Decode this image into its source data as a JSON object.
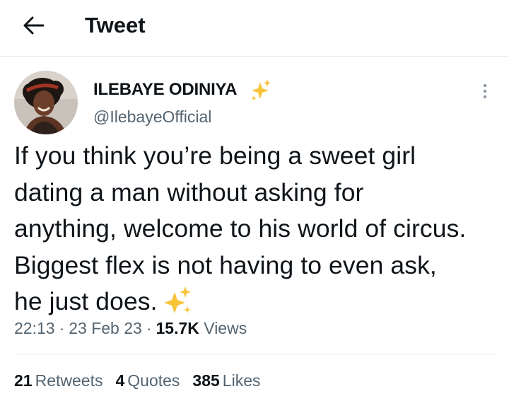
{
  "header": {
    "title": "Tweet",
    "back_icon": "arrow-left-icon"
  },
  "author": {
    "display_name": "ILEBAYE ODINIYA",
    "handle": "@IlebayeOfficial",
    "badge_icon": "sparkles-icon",
    "badge_color": "#f5b800"
  },
  "tweet": {
    "text": "If you think you’re being a sweet girl dating a man without asking for anything, welcome to his world of circus. Biggest flex is not having to even ask, he just does.",
    "trailing_icon": "sparkles-icon",
    "time": "22:13",
    "date": "23 Feb 23",
    "views_count": "15.7K",
    "views_label": "Views",
    "separator": "·"
  },
  "stats": {
    "retweets_count": "21",
    "retweets_label": "Retweets",
    "quotes_count": "4",
    "quotes_label": "Quotes",
    "likes_count": "385",
    "likes_label": "Likes"
  },
  "menu_icon": "more-vertical-icon"
}
